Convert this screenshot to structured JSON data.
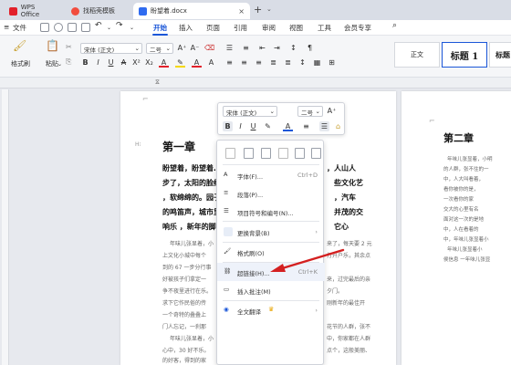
{
  "titlebar": {
    "tabs": [
      {
        "label": "WPS Office",
        "icon": "wps-logo-icon"
      },
      {
        "label": "找稻壳模板",
        "icon": "docer-logo-icon"
      },
      {
        "label": "盼望着.docx",
        "icon": "word-doc-icon"
      }
    ]
  },
  "menubar": {
    "file_label": "文件",
    "items": [
      "开始",
      "插入",
      "页面",
      "引用",
      "审阅",
      "视图",
      "工具",
      "会员专享"
    ],
    "active": "开始"
  },
  "ribbon": {
    "format_painter": "格式刷",
    "paste": "粘贴",
    "font_name": "宋体 (正文)",
    "font_size": "二号",
    "styles": [
      "正文",
      "标题 1",
      "标题"
    ]
  },
  "floating_toolbar": {
    "font_name": "宋体 (正文)",
    "font_size": "二号"
  },
  "context_menu": {
    "items": [
      {
        "label": "字体(F)...",
        "shortcut": "Ctrl+D",
        "icon": "font-icon"
      },
      {
        "label": "段落(P)...",
        "shortcut": "",
        "icon": "paragraph-icon"
      },
      {
        "label": "项目符号和编号(N)...",
        "shortcut": "",
        "icon": "bullets-icon"
      },
      {
        "label": "更换背景(B)",
        "shortcut": "",
        "icon": "background-icon"
      },
      {
        "label": "格式刷(O)",
        "shortcut": "",
        "icon": "format-painter-icon"
      },
      {
        "label": "超链接(H)...",
        "shortcut": "Ctrl+K",
        "icon": "hyperlink-icon"
      },
      {
        "label": "插入批注(M)",
        "shortcut": "",
        "icon": "comment-icon"
      },
      {
        "label": "全文翻译",
        "shortcut": "",
        "icon": "translate-icon"
      }
    ]
  },
  "document": {
    "chapter1_title": "第一章",
    "bold_lines": [
      "盼望着，盼望着……",
      "步了，太阳的脸红",
      "，软绵绵的。园子",
      "的鸣笛声，城市里",
      "响乐 ，新年的脚步"
    ],
    "bold_right": [
      "，人山人",
      "些文化艺",
      "，汽车",
      "并茂的交",
      "它心"
    ],
    "para_lines": [
      "年味儿张显着，小",
      "上文化小城中每个",
      "到的 67 一步分行事",
      "好被孩子们拿定一",
      "争不夜里进行在乐。",
      "求下它作民俗的传",
      "一个奇特的叠叠上",
      "门人忘记，一刹那",
      "年味儿张显着，小",
      "心中，30 好不乐。",
      "的好客，得到的家"
    ],
    "para_right": [
      "来了，每天要 2 元",
      "打开户乐，其余点",
      "来，过完最后的亲",
      "夕门。",
      "刚新年的最佳开",
      "花节的人群，张不",
      "中，你家都在人群",
      "点个，这般美丽、"
    ],
    "para2_lines": [
      "并的放时，天空",
      "比手挨地相互连接，",
      "挂烘烘在你爆程，",
      "年的嗓音，它们多",
      "新的会天，不不打",
      "让张的有心心。"
    ],
    "para2_right": [
      "在的长长发",
      "老的看在",
      "看的在",
      "也让",
      "你在",
      "对比地"
    ],
    "chapter2_title": "第二章",
    "page2_lines": [
      "年味儿张显着，小明",
      "的人群，张不住的一",
      "中，人大叫看着，",
      "看你被你的是，",
      "一次看你的家",
      "交大的心里有名",
      "面对这一次的是地",
      "中，人在看着的",
      "中，年味儿张显着小",
      "年味儿张显着小",
      "侯信息 一年味儿张显"
    ]
  }
}
